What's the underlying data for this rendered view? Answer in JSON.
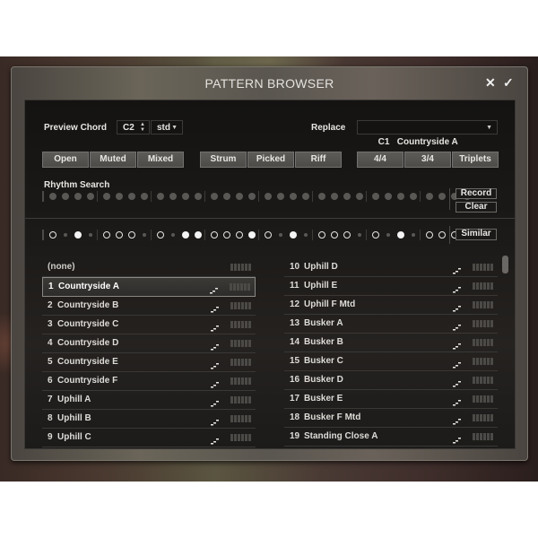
{
  "dialog": {
    "title": "PATTERN BROWSER",
    "close_icon": "close-icon",
    "confirm_icon": "checkmark-icon"
  },
  "preview_chord": {
    "label": "Preview Chord",
    "note": "C2",
    "type": "std"
  },
  "replace": {
    "label": "Replace",
    "value": "C1   Countryside A"
  },
  "filters": {
    "articulation": [
      "Open",
      "Muted",
      "Mixed"
    ],
    "style": [
      "Strum",
      "Picked",
      "Riff"
    ],
    "meter": [
      "4/4",
      "3/4",
      "Triplets"
    ]
  },
  "rhythm_search": {
    "label": "Rhythm Search",
    "input_steps": 32,
    "record_label": "Record",
    "clear_label": "Clear"
  },
  "pattern_row": {
    "steps": [
      "ring",
      "small",
      "fill",
      "small",
      "ring",
      "ring",
      "ring",
      "small",
      "ring",
      "small",
      "fill",
      "fill",
      "ring",
      "ring",
      "ring",
      "fill",
      "ring",
      "small",
      "fill",
      "small",
      "ring",
      "ring",
      "ring",
      "small",
      "ring",
      "small",
      "fill",
      "small",
      "ring",
      "ring",
      "ring",
      "small"
    ],
    "similar_label": "Similar"
  },
  "patterns": {
    "none_label": "(none)",
    "selected_index": 1,
    "left": [
      {
        "num": "1",
        "name": "Countryside A"
      },
      {
        "num": "2",
        "name": "Countryside B"
      },
      {
        "num": "3",
        "name": "Countryside C"
      },
      {
        "num": "4",
        "name": "Countryside D"
      },
      {
        "num": "5",
        "name": "Countryside E"
      },
      {
        "num": "6",
        "name": "Countryside F"
      },
      {
        "num": "7",
        "name": "Uphill A"
      },
      {
        "num": "8",
        "name": "Uphill B"
      },
      {
        "num": "9",
        "name": "Uphill C"
      }
    ],
    "right": [
      {
        "num": "10",
        "name": "Uphill D"
      },
      {
        "num": "11",
        "name": "Uphill E"
      },
      {
        "num": "12",
        "name": "Uphill F Mtd"
      },
      {
        "num": "13",
        "name": "Busker A"
      },
      {
        "num": "14",
        "name": "Busker B"
      },
      {
        "num": "15",
        "name": "Busker C"
      },
      {
        "num": "16",
        "name": "Busker D"
      },
      {
        "num": "17",
        "name": "Busker E"
      },
      {
        "num": "18",
        "name": "Busker F Mtd"
      },
      {
        "num": "19",
        "name": "Standing Close A"
      }
    ]
  }
}
